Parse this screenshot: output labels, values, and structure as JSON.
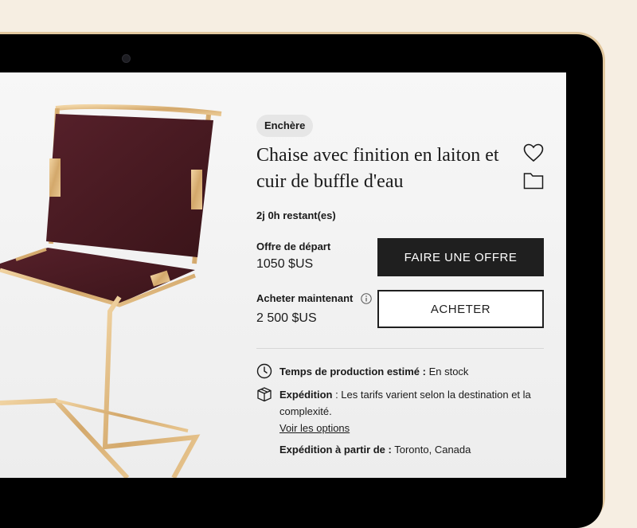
{
  "product": {
    "badge": "Enchère",
    "title": "Chaise avec finition en laiton et cuir de buffle d'eau",
    "time_left": "2j 0h restant(es)"
  },
  "pricing": {
    "start_offer_label": "Offre de départ",
    "start_offer_price": "1050 $US",
    "buy_now_label": "Acheter maintenant",
    "buy_now_price": "2 500 $US"
  },
  "actions": {
    "make_offer": "FAIRE UNE OFFRE",
    "buy": "ACHETER"
  },
  "details": {
    "production_label": "Temps de production estimé :",
    "production_value": "En stock",
    "shipping_label": "Expédition",
    "shipping_value": ": Les tarifs varient selon la destination et la complexité.",
    "shipping_link": "Voir les options",
    "ships_from_label": "Expédition à partir de :",
    "ships_from_value": "Toronto, Canada"
  },
  "icons": {
    "favorite": "heart-icon",
    "save": "folder-icon",
    "info": "info-icon",
    "clock": "clock-icon",
    "box": "box-icon"
  },
  "colors": {
    "background": "#f6eee2",
    "device_frame": "#e2c89f",
    "button_dark": "#1f1f1f",
    "leather": "#4a1a20",
    "brass": "#d9b27a"
  }
}
